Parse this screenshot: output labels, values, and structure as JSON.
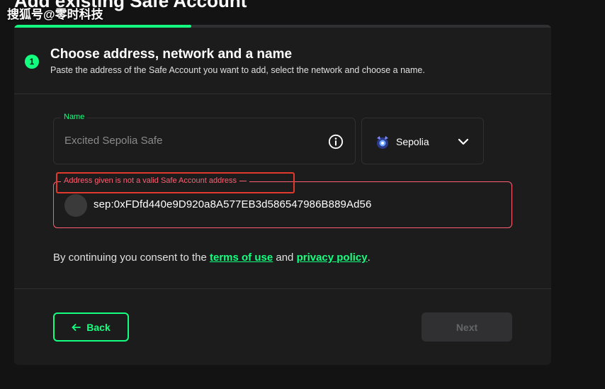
{
  "page": {
    "title": "Add existing Safe Account",
    "watermark": "搜狐号@零时科技"
  },
  "progress": {
    "value": 0.33
  },
  "step": {
    "number": "1",
    "title": "Choose address, network and a name",
    "subtitle": "Paste the address of the Safe Account you want to add, select the network and choose a name."
  },
  "name_field": {
    "label": "Name",
    "placeholder": "Excited Sepolia Safe",
    "value": ""
  },
  "network": {
    "selected": "Sepolia"
  },
  "address_field": {
    "error": "Address given is not a valid Safe Account address",
    "value": "sep:0xFDfd440e9D920a8A577EB3d586547986B889Ad56"
  },
  "consent": {
    "prefix": "By continuing you consent to the ",
    "terms_link": "terms of use",
    "middle": " and ",
    "privacy_link": "privacy policy",
    "suffix": "."
  },
  "actions": {
    "back_label": "Back",
    "next_label": "Next"
  },
  "colors": {
    "accent": "#12ff80",
    "error": "#ff5f72",
    "card_bg": "#1c1c1c",
    "page_bg": "#121312"
  },
  "icons": {
    "info": "info-icon",
    "network": "sepolia-network-icon",
    "dropdown": "chevron-down-icon",
    "back": "arrow-left-icon"
  }
}
